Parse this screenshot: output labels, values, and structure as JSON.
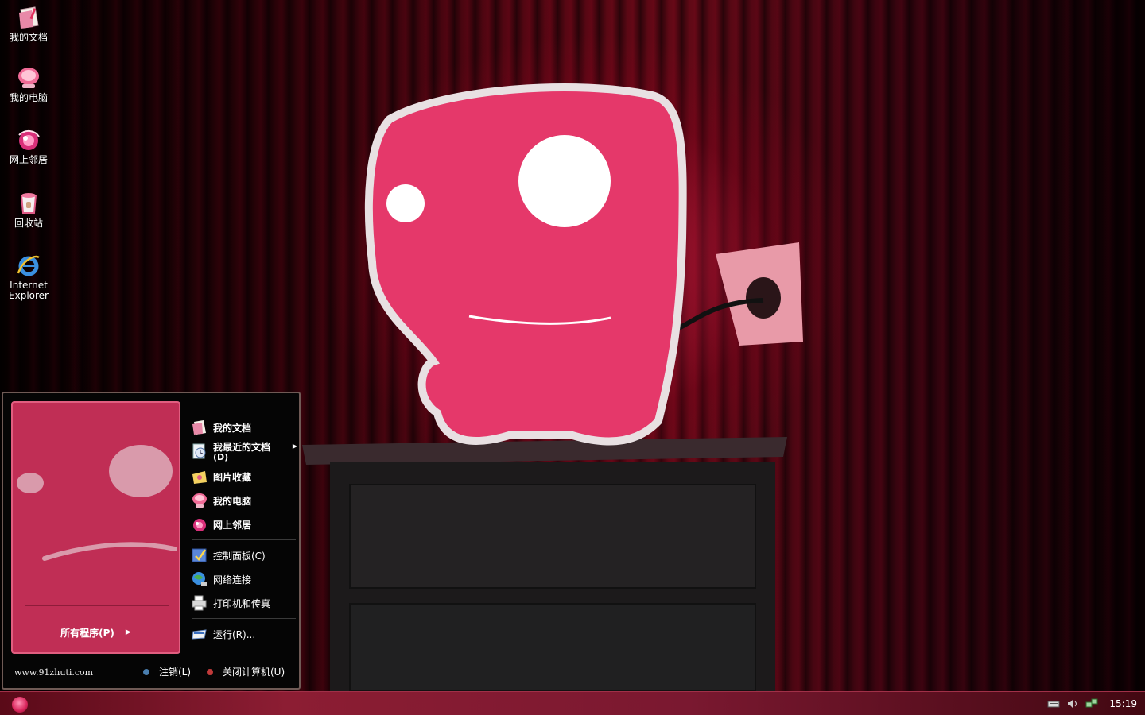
{
  "desktop": {
    "icons": [
      {
        "label": "我的文档",
        "icon": "my-documents-icon"
      },
      {
        "label": "我的电脑",
        "icon": "my-computer-icon"
      },
      {
        "label": "网上邻居",
        "icon": "network-places-icon"
      },
      {
        "label": "回收站",
        "icon": "recycle-bin-icon"
      },
      {
        "label": "Internet Explorer",
        "icon": "internet-explorer-icon"
      }
    ]
  },
  "start_menu": {
    "all_programs": "所有程序(P)",
    "places": [
      {
        "label": "我的文档",
        "icon": "my-documents-icon"
      },
      {
        "label": "我最近的文档",
        "shortcut": "(D)",
        "icon": "recent-documents-icon"
      },
      {
        "label": "图片收藏",
        "icon": "my-pictures-icon"
      },
      {
        "label": "我的电脑",
        "icon": "my-computer-icon"
      },
      {
        "label": "网上邻居",
        "icon": "network-places-icon"
      }
    ],
    "settings": [
      {
        "label": "控制面板(C)",
        "icon": "control-panel-icon"
      },
      {
        "label": "网络连接",
        "icon": "network-connections-icon"
      },
      {
        "label": "打印机和传真",
        "icon": "printers-faxes-icon"
      }
    ],
    "run": {
      "label": "运行(R)...",
      "icon": "run-icon"
    },
    "watermark": "www.91zhuti.com",
    "logoff": "注销(L)",
    "shutdown": "关闭计算机(U)"
  },
  "taskbar": {
    "clock": "15:19",
    "tray_icons": [
      "keyboard-icon",
      "volume-icon",
      "network-tray-icon"
    ]
  },
  "colors": {
    "accent": "#c02e55",
    "taskbar": "#8c1d33"
  }
}
